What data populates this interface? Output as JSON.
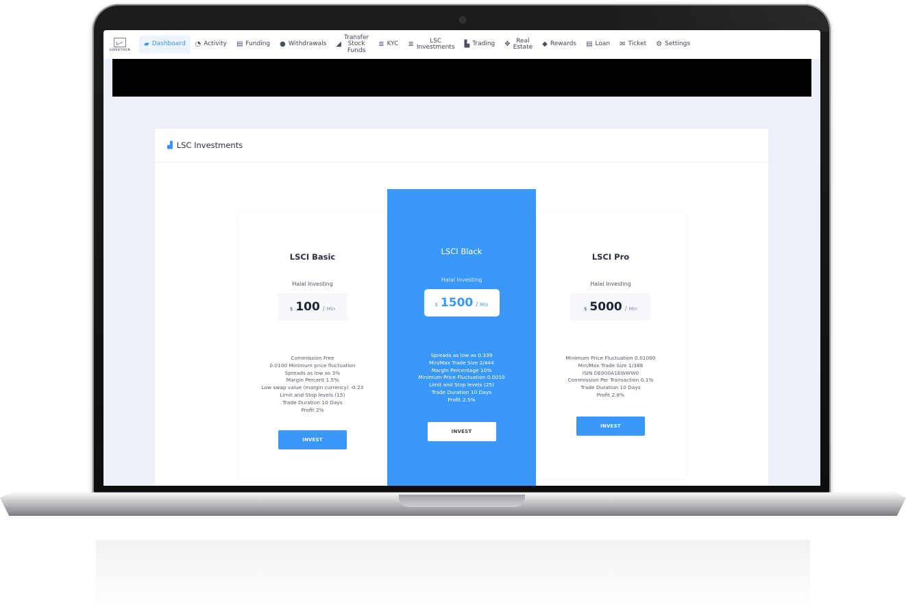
{
  "brand": {
    "logo_text": "LIVESTOCK"
  },
  "nav": {
    "items": [
      {
        "label": "Dashboard",
        "icon": "briefcase-icon",
        "active": true
      },
      {
        "label": "Activity",
        "icon": "clock-icon"
      },
      {
        "label": "Funding",
        "icon": "cash-icon"
      },
      {
        "label": "Withdrawals",
        "icon": "coin-icon"
      },
      {
        "label_lines": [
          "Transfer",
          "Stock",
          "Funds"
        ],
        "icon": "send-icon"
      },
      {
        "label": "KYC",
        "icon": "database-icon"
      },
      {
        "label_lines": [
          "LSC",
          "Investments"
        ],
        "icon": "database-icon"
      },
      {
        "label": "Trading",
        "icon": "chart-icon"
      },
      {
        "label_lines": [
          "Real",
          "Estate"
        ],
        "icon": "move-icon"
      },
      {
        "label": "Rewards",
        "icon": "diamond-icon"
      },
      {
        "label": "Loan",
        "icon": "cash-icon"
      },
      {
        "label": "Ticket",
        "icon": "mail-icon"
      },
      {
        "label": "Settings",
        "icon": "gear-icon"
      }
    ]
  },
  "section": {
    "title": "LSC Investments",
    "icon": "bar-chart-icon"
  },
  "plans": [
    {
      "name": "LSCI Basic",
      "subtitle": "Halal Investing",
      "currency": "$",
      "amount": "100",
      "per": "Min",
      "features": [
        "Commission Free",
        "0.0100 Minimum price fluctuation",
        "Spreads as low as 3%",
        "Margin Percent 1.5%",
        "Low swap value (margin currency) -0.23",
        "Limit and Stop levels (15)",
        "Trade Duration 10 Days",
        "Profit 2%"
      ],
      "cta": "INVEST"
    },
    {
      "name": "LSCI Black",
      "subtitle": "Halal Investing",
      "currency": "$",
      "amount": "1500",
      "per": "Min",
      "features": [
        "Spreads as low as 0.339",
        "Min/Max Trade Size 2/444",
        "Margin Percentage 10%",
        "Minimum Price Fluctuation 0.0010",
        "Limit and Stop levels (25)",
        "Trade Duration 10 Days",
        "Profit 2.5%"
      ],
      "cta": "INVEST"
    },
    {
      "name": "LSCI Pro",
      "subtitle": "Halal Investing",
      "currency": "$",
      "amount": "5000",
      "per": "Min",
      "features": [
        "Minimum Price Fluctuation 0.01000",
        "Min/Max Trade Size 1/388",
        "ISIN DE000A1EWWW0",
        "Commission Per Transaction 0.1%",
        "Trade Duration 10 Days",
        "Profit 2.8%"
      ],
      "cta": "INVEST"
    }
  ],
  "colors": {
    "accent": "#3a98fb",
    "page_bg": "#eef0f8",
    "text": "#2b2f3b"
  }
}
